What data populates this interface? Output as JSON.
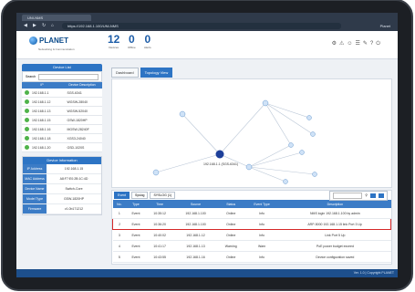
{
  "browser": {
    "tab_title": "UNI-NMS",
    "address": "https://192.168.1.100/UNI-NMS",
    "profile": "Planet"
  },
  "header": {
    "brand": "PLANET",
    "brand_sub": "Networking & Communication",
    "stats": [
      {
        "value": "12",
        "label": "Devices"
      },
      {
        "value": "0",
        "label": "Offline"
      },
      {
        "value": "0",
        "label": "Alerts"
      }
    ],
    "icons": [
      "gear-icon",
      "alert-icon",
      "user-icon",
      "settings-icon",
      "tool-icon",
      "help-icon",
      "power-icon"
    ]
  },
  "left_panel": {
    "title": "Device List",
    "search_label": "Search",
    "columns": [
      "IP",
      "Device Description"
    ],
    "devices": [
      {
        "ip": "192.168.1.1",
        "desc": "SGS-6341"
      },
      {
        "ip": "192.168.1.12",
        "desc": "WGSW-28040"
      },
      {
        "ip": "192.168.1.13",
        "desc": "WGSW-52040"
      },
      {
        "ip": "192.168.1.15",
        "desc": "GSW-1820HP"
      },
      {
        "ip": "192.168.1.16",
        "desc": "MGSW-28240F"
      },
      {
        "ip": "192.168.1.18",
        "desc": "XGS3-24040"
      },
      {
        "ip": "192.168.1.20",
        "desc": "GSD-1020S"
      }
    ],
    "info": {
      "title": "Device Information",
      "rows": [
        {
          "k": "IP Address",
          "v": "192.168.1.15"
        },
        {
          "k": "MAC Address",
          "v": "A8:F7:E0:2B:1C:4D"
        },
        {
          "k": "Device Name",
          "v": "Switch-Core"
        },
        {
          "k": "Model Type",
          "v": "GSW-1820HP"
        },
        {
          "k": "Firmware",
          "v": "v1.0b171212"
        }
      ]
    }
  },
  "topology": {
    "tabs": [
      "Dashboard",
      "Topology View"
    ],
    "active_tab": 1,
    "center_label": "192.168.1.1 (SGS-6341)"
  },
  "log": {
    "tabs": [
      "Event",
      "Syslog",
      "SYSLOG (1)"
    ],
    "search_placeholder": "Search",
    "columns": [
      "No.",
      "Type",
      "Time",
      "Source",
      "Status",
      "Event Type",
      "Description"
    ],
    "rows": [
      {
        "no": "1",
        "type": "Event",
        "time": "10:35:12",
        "src": "192.168.1.100",
        "status": "Online",
        "etype": "Info",
        "desc": "NMS login 192.168.1.100 by admin"
      },
      {
        "no": "2",
        "type": "Event",
        "time": "10:36:20",
        "src": "192.168.1.100",
        "status": "Online",
        "etype": "Info",
        "desc": "ARP-5000 192.168.1.15 link Port 3 Up"
      },
      {
        "no": "3",
        "type": "Event",
        "time": "10:40:02",
        "src": "192.168.1.12",
        "status": "Online",
        "etype": "Info",
        "desc": "Link Port 5 Up"
      },
      {
        "no": "4",
        "type": "Event",
        "time": "10:41:17",
        "src": "192.168.1.13",
        "status": "Warning",
        "etype": "Warn",
        "desc": "PoE power budget exceed"
      },
      {
        "no": "5",
        "type": "Event",
        "time": "10:43:55",
        "src": "192.168.1.16",
        "status": "Online",
        "etype": "Info",
        "desc": "Device configuration saved"
      }
    ]
  },
  "status_bar": {
    "text": "Ver. 1.0 | Copyright PLANET"
  }
}
